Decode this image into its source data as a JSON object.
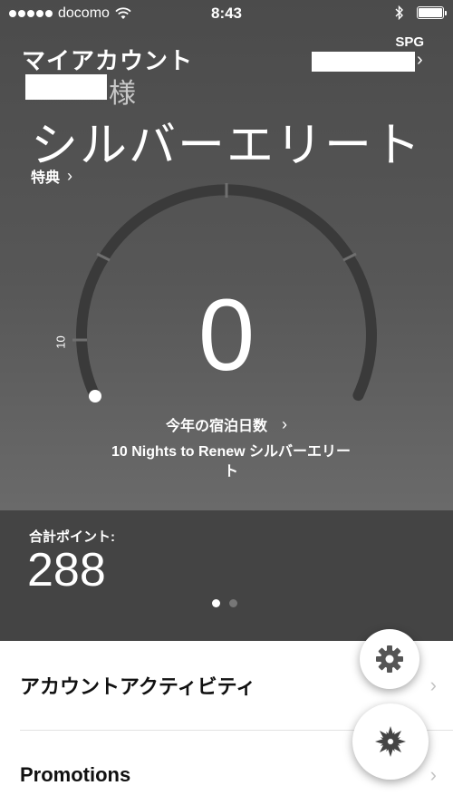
{
  "status_bar": {
    "carrier": "docomo",
    "time": "8:43"
  },
  "header": {
    "account_label": "マイアカウント",
    "honorific": "様",
    "spg_label": "SPG",
    "tier_name": "シルバーエリート",
    "benefits_label": "特典"
  },
  "gauge": {
    "nights_value": "0",
    "tick_label": "10",
    "nights_label": "今年の宿泊日数",
    "renew_text": "10 Nights to Renew シルバーエリート",
    "progress": 0
  },
  "points": {
    "label": "合計ポイント:",
    "value": "288"
  },
  "pager": {
    "page_count": 2,
    "active_page": 1
  },
  "list": {
    "items": [
      {
        "label": "アカウントアクティビティ"
      },
      {
        "label": "Promotions"
      }
    ]
  },
  "icons": {
    "settings": "gear-icon",
    "main": "starburst-icon",
    "chevron": "chevron-right-icon"
  },
  "colors": {
    "background_dark": "#4a4a4a",
    "points_bg": "#444444",
    "list_bg": "#ffffff"
  }
}
